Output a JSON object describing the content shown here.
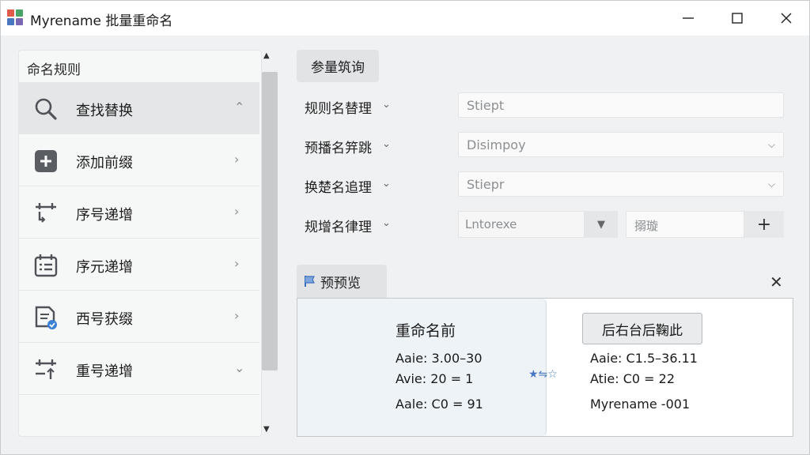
{
  "window": {
    "title": "Myrename 批量重命名",
    "controls": {
      "minimize": "minimize",
      "maximize": "maximize",
      "close": "close"
    }
  },
  "sidebar": {
    "title": "命名规则",
    "items": [
      {
        "label": "查找替换",
        "icon": "search-icon",
        "state": "expanded"
      },
      {
        "label": "添加前缀",
        "icon": "plus-square-icon",
        "state": "collapsed"
      },
      {
        "label": "序号递增",
        "icon": "calendar-sequence-icon",
        "state": "collapsed"
      },
      {
        "label": "序元递增",
        "icon": "calendar-list-icon",
        "state": "collapsed"
      },
      {
        "label": "西号获缀",
        "icon": "document-check-icon",
        "state": "collapsed"
      },
      {
        "label": "重号递增",
        "icon": "calendar-arrows-icon",
        "state": "collapsed"
      }
    ]
  },
  "params": {
    "tab_label": "参量筑询",
    "rows": [
      {
        "label": "规则名替理",
        "value": "Stiept"
      },
      {
        "label": "预播名笄跳",
        "value": "Disimpoy"
      },
      {
        "label": "换楚名追理",
        "value": "Stiepr"
      },
      {
        "label": "规增名律理",
        "value_left": "Lntorexe",
        "value_right": "搦璇"
      }
    ]
  },
  "preview": {
    "tab_label": "预预览",
    "before_title": "重命名前",
    "before_lines": [
      "Aaie:  3.00–30",
      "Avie: 20 = 1",
      "Aale: C0 = 91"
    ],
    "after_button": "后右台后鞠此",
    "after_lines": [
      "Aaie: C1.5–36.11",
      "Atie: C0 = 22",
      "Myrename -001"
    ]
  },
  "colors": {
    "accent": "#4a78c0",
    "window_bg": "#f0f1f2",
    "active_item": "#e4e6e7"
  }
}
